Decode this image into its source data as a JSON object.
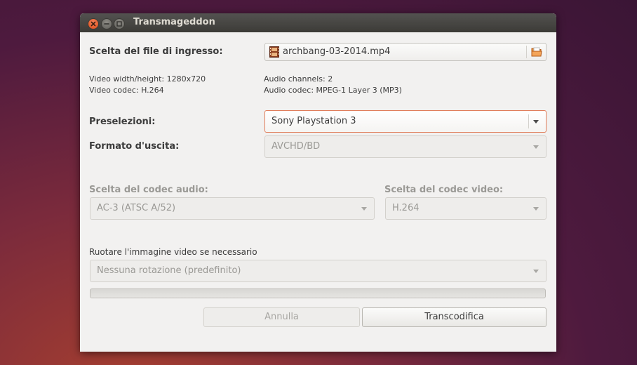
{
  "window": {
    "title": "Transmageddon"
  },
  "input": {
    "label": "Scelta del file di ingresso:",
    "filename": "archbang-03-2014.mp4"
  },
  "info": {
    "video_size": "Video width/height: 1280x720",
    "video_codec": "Video codec: H.264",
    "audio_channels": "Audio channels: 2",
    "audio_codec": "Audio codec: MPEG-1 Layer 3 (MP3)"
  },
  "presets": {
    "label": "Preselezioni:",
    "value": "Sony Playstation 3"
  },
  "output_format": {
    "label": "Formato d'uscita:",
    "value": "AVCHD/BD"
  },
  "audio_codec_choice": {
    "label": "Scelta del codec audio:",
    "value": "AC-3 (ATSC A/52)"
  },
  "video_codec_choice": {
    "label": "Scelta del codec video:",
    "value": "H.264"
  },
  "rotation": {
    "label": "Ruotare l'immagine video se necessario",
    "value": "Nessuna rotazione (predefinito)"
  },
  "progress": {
    "fraction": 0
  },
  "buttons": {
    "cancel": "Annulla",
    "transcode": "Transcodifica"
  },
  "colors": {
    "accent": "#e07d5a",
    "close_button": "#df4a16",
    "titlebar": "#3c3b37"
  },
  "icons": {
    "file": "video-file-icon",
    "open": "folder-open-icon"
  }
}
